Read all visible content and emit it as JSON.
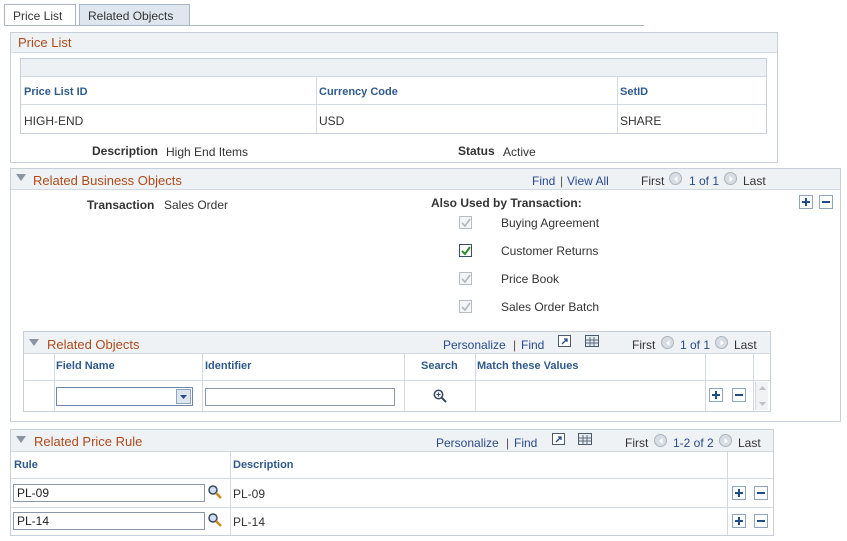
{
  "tabs": [
    {
      "label": "Price List"
    },
    {
      "label": "Related Objects"
    }
  ],
  "price_list": {
    "title": "Price List",
    "headers": {
      "id": "Price List ID",
      "currency": "Currency Code",
      "setid": "SetID"
    },
    "row": {
      "id": "HIGH-END",
      "currency": "USD",
      "setid": "SHARE"
    },
    "description_label": "Description",
    "description_value": "High End Items",
    "status_label": "Status",
    "status_value": "Active"
  },
  "related_business_objects": {
    "title": "Related Business Objects",
    "nav": {
      "find": "Find",
      "sep": "|",
      "view_all": "View All",
      "first": "First",
      "count": "1 of 1",
      "last": "Last"
    },
    "transaction_label": "Transaction",
    "transaction_value": "Sales Order",
    "also_used_label": "Also Used by Transaction:",
    "checkboxes": [
      {
        "label": "Buying Agreement",
        "checked": true,
        "disabled": true
      },
      {
        "label": "Customer Returns",
        "checked": true,
        "disabled": false
      },
      {
        "label": "Price Book",
        "checked": true,
        "disabled": true
      },
      {
        "label": "Sales Order Batch",
        "checked": true,
        "disabled": true
      }
    ]
  },
  "related_objects": {
    "title": "Related Objects",
    "nav": {
      "personalize": "Personalize",
      "sep": "|",
      "find": "Find",
      "first": "First",
      "count": "1 of 1",
      "last": "Last"
    },
    "headers": {
      "field": "Field Name",
      "identifier": "Identifier",
      "search": "Search",
      "match": "Match these Values"
    },
    "row": {
      "field": "",
      "identifier": ""
    }
  },
  "related_price_rule": {
    "title": "Related Price Rule",
    "nav": {
      "personalize": "Personalize",
      "sep": "|",
      "find": "Find",
      "first": "First",
      "count": "1-2 of 2",
      "last": "Last"
    },
    "headers": {
      "rule": "Rule",
      "description": "Description"
    },
    "rows": [
      {
        "rule": "PL-09",
        "description": "PL-09"
      },
      {
        "rule": "PL-14",
        "description": "PL-14"
      }
    ]
  },
  "colors": {
    "accent_title": "#b04a1a",
    "link": "#2a4a8c",
    "header_text": "#2f5a8c"
  }
}
